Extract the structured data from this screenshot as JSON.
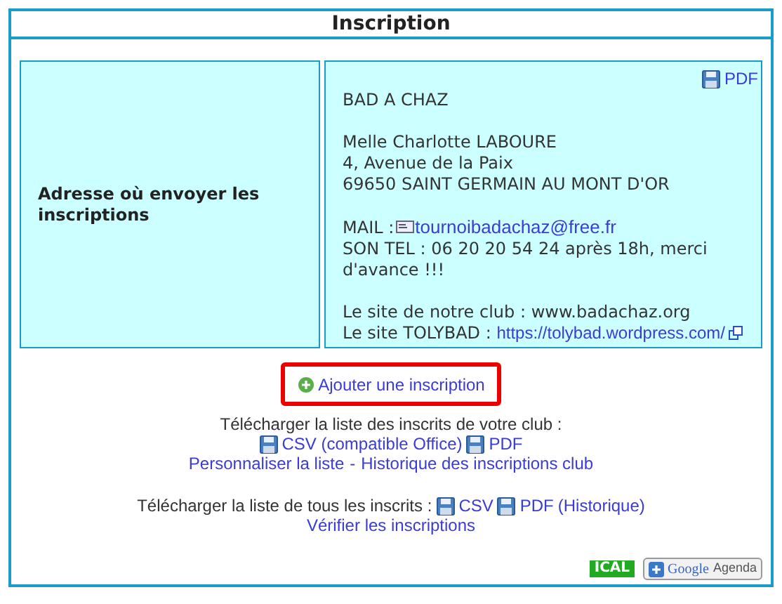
{
  "title": "Inscription",
  "address": {
    "label": "Adresse où envoyer les inscriptions",
    "pdf": "PDF",
    "paragraphs": [
      [
        {
          "kind": "text",
          "text": "BAD A CHAZ"
        }
      ],
      [
        {
          "kind": "text",
          "text": "Melle Charlotte LABOURE"
        },
        {
          "kind": "text",
          "text": "4, Avenue de la Paix"
        },
        {
          "kind": "text",
          "text": "69650 SAINT GERMAIN AU MONT D'OR"
        }
      ],
      [
        {
          "kind": "mail",
          "text": "MAIL :",
          "link": "tournoibadachaz@free.fr"
        },
        {
          "kind": "text",
          "text": "SON TEL : 06 20 20 54 24 après 18h, merci d'avance !!!"
        }
      ],
      [
        {
          "kind": "text",
          "text": "Le site de notre club : www.badachaz.org"
        },
        {
          "kind": "link",
          "text": "Le site TOLYBAD :",
          "link": "https://tolybad.wordpress.com/"
        }
      ]
    ]
  },
  "add_button": {
    "label": "Ajouter une inscription",
    "highlighted": true
  },
  "club_download": {
    "label": "Télécharger la liste des inscrits de votre club :",
    "files": [
      "CSV (compatible Office)",
      "PDF"
    ],
    "links": [
      "Personnaliser la liste",
      "Historique des inscriptions club"
    ],
    "separator": "-"
  },
  "all_download": {
    "label": "Télécharger la liste de tous les inscrits :",
    "files": [
      "CSV",
      "PDF"
    ],
    "history": "(Historique)",
    "verify": "Vérifier les inscriptions"
  },
  "footer": {
    "ical": "ICAL",
    "google": "Google",
    "agenda": "Agenda"
  }
}
